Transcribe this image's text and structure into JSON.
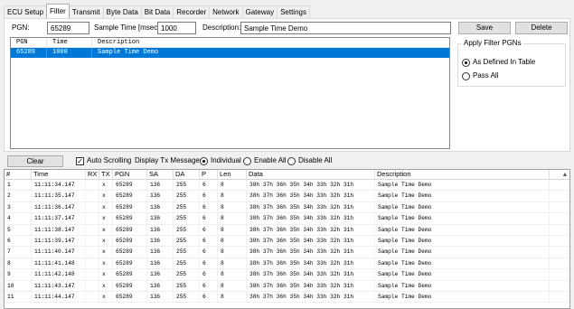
{
  "tabs": [
    {
      "label": "ECU Setup"
    },
    {
      "label": "Filter"
    },
    {
      "label": "Transmit"
    },
    {
      "label": "Byte Data"
    },
    {
      "label": "Bit Data"
    },
    {
      "label": "Recorder"
    },
    {
      "label": "Network"
    },
    {
      "label": "Gateway"
    },
    {
      "label": "Settings"
    }
  ],
  "filter": {
    "pgn_label": "PGN:",
    "pgn_value": "65289",
    "sample_label": "Sample Time [msec]:",
    "sample_value": "1000",
    "desc_label": "Description:",
    "desc_value": "Sample Time Demo",
    "save_label": "Save",
    "delete_label": "Delete",
    "list_headers": {
      "pgn": "PGN",
      "time": "Time",
      "desc": "Description"
    },
    "list_rows": [
      {
        "pgn": "65289",
        "time": "1000",
        "desc": "Sample Time Demo"
      }
    ],
    "apply_title": "Apply Filter PGNs",
    "opt_defined": "As Defined In Table",
    "opt_passall": "Pass All",
    "selected_option": "As Defined In Table"
  },
  "toolbar": {
    "clear_label": "Clear",
    "auto_scroll_label": "Auto Scrolling",
    "auto_scroll_checked": true,
    "display_label": "Display Tx Messages:",
    "opt_individual": "Individual",
    "opt_enable_all": "Enable All",
    "opt_disable_all": "Disable All",
    "selected_option": "Individual"
  },
  "grid": {
    "headers": {
      "num": "#",
      "time": "Time",
      "rx": "RX",
      "tx": "TX",
      "pgn": "PGN",
      "sa": "SA",
      "da": "DA",
      "p": "P",
      "len": "Len",
      "data": "Data",
      "desc": "Description"
    },
    "rows": [
      {
        "num": "1",
        "time": "11:11:34.147",
        "rx": "",
        "tx": "x",
        "pgn": "65289",
        "sa": "136",
        "da": "255",
        "p": "6",
        "len": "8",
        "data": "38h 37h 36h 35h 34h 33h 32h 31h",
        "desc": "Sample Time Demo"
      },
      {
        "num": "2",
        "time": "11:11:35.147",
        "rx": "",
        "tx": "x",
        "pgn": "65289",
        "sa": "136",
        "da": "255",
        "p": "6",
        "len": "8",
        "data": "38h 37h 36h 35h 34h 33h 32h 31h",
        "desc": "Sample Time Demo"
      },
      {
        "num": "3",
        "time": "11:11:36.147",
        "rx": "",
        "tx": "x",
        "pgn": "65289",
        "sa": "136",
        "da": "255",
        "p": "6",
        "len": "8",
        "data": "38h 37h 36h 35h 34h 33h 32h 31h",
        "desc": "Sample Time Demo"
      },
      {
        "num": "4",
        "time": "11:11:37.147",
        "rx": "",
        "tx": "x",
        "pgn": "65289",
        "sa": "136",
        "da": "255",
        "p": "6",
        "len": "8",
        "data": "38h 37h 36h 35h 34h 33h 32h 31h",
        "desc": "Sample Time Demo"
      },
      {
        "num": "5",
        "time": "11:11:38.147",
        "rx": "",
        "tx": "x",
        "pgn": "65289",
        "sa": "136",
        "da": "255",
        "p": "6",
        "len": "8",
        "data": "38h 37h 36h 35h 34h 33h 32h 31h",
        "desc": "Sample Time Demo"
      },
      {
        "num": "6",
        "time": "11:11:39.147",
        "rx": "",
        "tx": "x",
        "pgn": "65289",
        "sa": "136",
        "da": "255",
        "p": "6",
        "len": "8",
        "data": "38h 37h 36h 35h 34h 33h 32h 31h",
        "desc": "Sample Time Demo"
      },
      {
        "num": "7",
        "time": "11:11:40.147",
        "rx": "",
        "tx": "x",
        "pgn": "65289",
        "sa": "136",
        "da": "255",
        "p": "6",
        "len": "8",
        "data": "38h 37h 36h 35h 34h 33h 32h 31h",
        "desc": "Sample Time Demo"
      },
      {
        "num": "8",
        "time": "11:11:41.148",
        "rx": "",
        "tx": "x",
        "pgn": "65289",
        "sa": "136",
        "da": "255",
        "p": "6",
        "len": "8",
        "data": "38h 37h 36h 35h 34h 33h 32h 31h",
        "desc": "Sample Time Demo"
      },
      {
        "num": "9",
        "time": "11:11:42.148",
        "rx": "",
        "tx": "x",
        "pgn": "65289",
        "sa": "136",
        "da": "255",
        "p": "6",
        "len": "8",
        "data": "38h 37h 36h 35h 34h 33h 32h 31h",
        "desc": "Sample Time Demo"
      },
      {
        "num": "10",
        "time": "11:11:43.147",
        "rx": "",
        "tx": "x",
        "pgn": "65289",
        "sa": "136",
        "da": "255",
        "p": "6",
        "len": "8",
        "data": "38h 37h 36h 35h 34h 33h 32h 31h",
        "desc": "Sample Time Demo"
      },
      {
        "num": "11",
        "time": "11:11:44.147",
        "rx": "",
        "tx": "x",
        "pgn": "65289",
        "sa": "136",
        "da": "255",
        "p": "6",
        "len": "8",
        "data": "38h 37h 36h 35h 34h 33h 32h 31h",
        "desc": "Sample Time Demo"
      }
    ]
  },
  "colors": {
    "selection": "#0078d7",
    "window_bg": "#f0f0f0",
    "accent": "#0078d7"
  },
  "icons": {
    "scroll_up": "chevron-up-icon"
  }
}
